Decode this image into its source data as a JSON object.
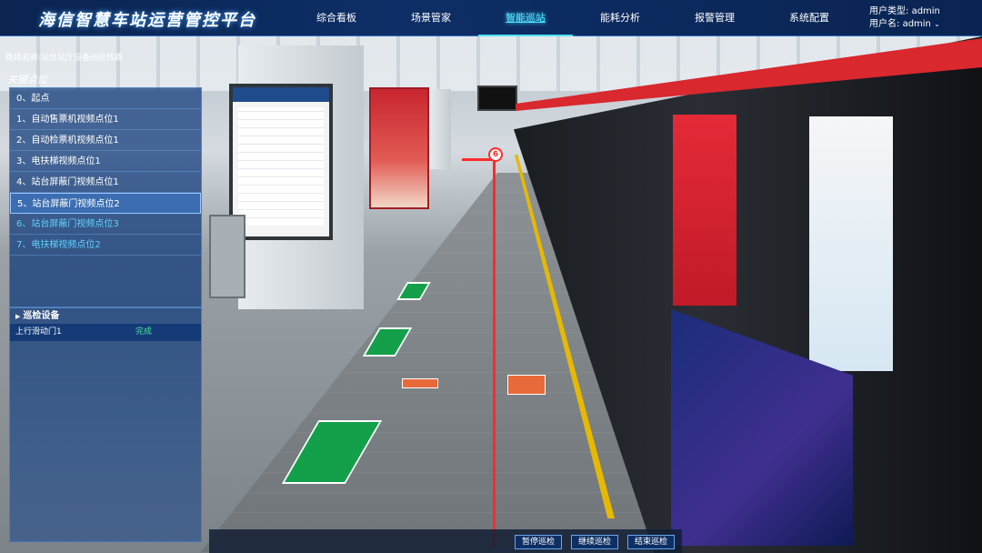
{
  "header": {
    "title": "海信智慧车站运营管控平台",
    "nav": [
      {
        "label": "综合看板"
      },
      {
        "label": "场景管家"
      },
      {
        "label": "智能巡站",
        "active": true
      },
      {
        "label": "能耗分析"
      },
      {
        "label": "报警管理"
      },
      {
        "label": "系统配置"
      }
    ],
    "user_type_label": "用户类型:",
    "user_type_value": "admin",
    "user_name_label": "用户名:",
    "user_name_value": "admin"
  },
  "route": {
    "label": "路线名称:",
    "value": "站台站厅设备巡检线路"
  },
  "key_points": {
    "title": "关键点位",
    "items": [
      {
        "label": "0、起点",
        "state": "done"
      },
      {
        "label": "1、自动售票机视频点位1",
        "state": "done"
      },
      {
        "label": "2、自动检票机视频点位1",
        "state": "done"
      },
      {
        "label": "3、电扶梯视频点位1",
        "state": "done"
      },
      {
        "label": "4、站台屏蔽门视频点位1",
        "state": "done"
      },
      {
        "label": "5、站台屏蔽门视频点位2",
        "state": "current"
      },
      {
        "label": "6、站台屏蔽门视频点位3",
        "state": "pending"
      },
      {
        "label": "7、电扶梯视频点位2",
        "state": "pending"
      }
    ]
  },
  "devices": {
    "title": "巡检设备",
    "rows": [
      {
        "name": "上行滑动门1",
        "status": "完成"
      }
    ]
  },
  "scene": {
    "marker_number": "6"
  },
  "controls": {
    "pause": "暂停巡检",
    "resume": "继续巡检",
    "stop": "结束巡检"
  },
  "colors": {
    "accent": "#4ee0ff",
    "status_done": "#4be29b",
    "path": "#ff2b2b"
  }
}
